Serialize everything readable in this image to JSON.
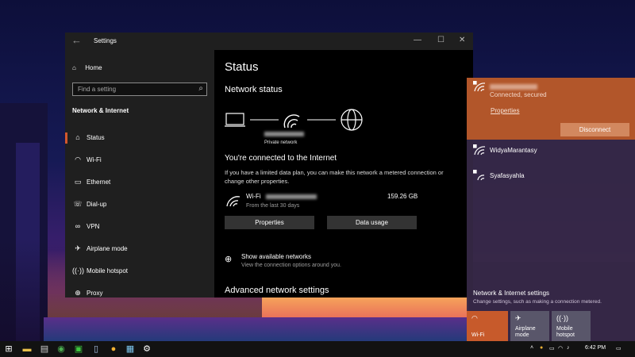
{
  "window": {
    "title": "Settings",
    "controls": [
      "—",
      "☐",
      "✕"
    ]
  },
  "sidebar": {
    "home_label": "Home",
    "search_placeholder": "Find a setting",
    "section_title": "Network & Internet",
    "items": [
      {
        "label": "Status",
        "icon": "home-globe-icon"
      },
      {
        "label": "Wi-Fi",
        "icon": "wifi-icon"
      },
      {
        "label": "Ethernet",
        "icon": "ethernet-icon"
      },
      {
        "label": "Dial-up",
        "icon": "dialup-icon"
      },
      {
        "label": "VPN",
        "icon": "vpn-icon"
      },
      {
        "label": "Airplane mode",
        "icon": "airplane-icon"
      },
      {
        "label": "Mobile hotspot",
        "icon": "hotspot-icon"
      },
      {
        "label": "Proxy",
        "icon": "globe-icon"
      }
    ],
    "selected": "Status"
  },
  "main": {
    "title": "Status",
    "network_status_heading": "Network status",
    "network_type": "Private network",
    "connected_heading": "You're connected to the Internet",
    "connected_text": "If you have a limited data plan, you can make this network a metered connection or change other properties.",
    "wifi_label": "Wi-Fi",
    "wifi_subtitle": "From the last 30 days",
    "data_usage_value": "159.26 GB",
    "properties_button": "Properties",
    "data_usage_button": "Data usage",
    "show_networks_title": "Show available networks",
    "show_networks_subtitle": "View the connection options around you.",
    "advanced_heading": "Advanced network settings"
  },
  "flyout": {
    "connected_status": "Connected, secured",
    "properties_link": "Properties",
    "disconnect_button": "Disconnect",
    "networks": [
      "WidyaMarantasy",
      "Syafasyahla"
    ],
    "settings_title": "Network & Internet settings",
    "settings_desc": "Change settings, such as making a connection metered.",
    "quick_actions": [
      {
        "label": "Wi-Fi",
        "active": true
      },
      {
        "label": "Airplane mode",
        "active": false
      },
      {
        "label": "Mobile hotspot",
        "active": false
      }
    ],
    "accent_color": "#b2562a"
  },
  "taskbar": {
    "time": "6:42 PM"
  }
}
